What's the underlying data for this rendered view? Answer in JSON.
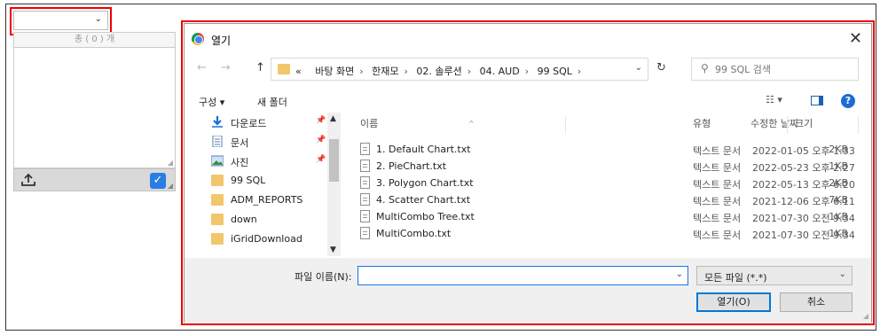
{
  "left_panel": {
    "count_label": "총 ( 0 ) 개",
    "combo_value": ""
  },
  "dialog": {
    "title": "열기",
    "breadcrumbs": [
      "«",
      "바탕 화면",
      "한재모",
      "02. 솔루션",
      "04. AUD",
      "99 SQL"
    ],
    "search_placeholder": "99 SQL 검색",
    "organize_label": "구성 ▾",
    "new_folder_label": "새 폴더",
    "nav_items": [
      {
        "label": "다운로드",
        "icon": "download-arrow-icon",
        "pinned": true
      },
      {
        "label": "문서",
        "icon": "document-icon",
        "pinned": true
      },
      {
        "label": "사진",
        "icon": "picture-icon",
        "pinned": true
      },
      {
        "label": "99 SQL",
        "icon": "folder-icon",
        "pinned": false
      },
      {
        "label": "ADM_REPORTS",
        "icon": "folder-icon",
        "pinned": false
      },
      {
        "label": "down",
        "icon": "folder-icon",
        "pinned": false
      },
      {
        "label": "iGridDownload",
        "icon": "folder-icon",
        "pinned": false
      }
    ],
    "columns": {
      "name": "이름",
      "modified": "수정한 날짜",
      "type": "유형",
      "size": "크기"
    },
    "files": [
      {
        "name": "1. Default Chart.txt",
        "modified": "2022-01-05 오후 1:33",
        "type": "텍스트 문서",
        "size": "2KB"
      },
      {
        "name": "2. PieChart.txt",
        "modified": "2022-05-23 오후 2:27",
        "type": "텍스트 문서",
        "size": "1KB"
      },
      {
        "name": "3. Polygon Chart.txt",
        "modified": "2022-05-13 오후 6:20",
        "type": "텍스트 문서",
        "size": "2KB"
      },
      {
        "name": "4. Scatter Chart.txt",
        "modified": "2021-12-06 오후 6:11",
        "type": "텍스트 문서",
        "size": "7KB"
      },
      {
        "name": "MultiCombo Tree.txt",
        "modified": "2021-07-30 오전 9:34",
        "type": "텍스트 문서",
        "size": "1KB"
      },
      {
        "name": "MultiCombo.txt",
        "modified": "2021-07-30 오전 9:34",
        "type": "텍스트 문서",
        "size": "1KB"
      }
    ],
    "filename_label": "파일 이름(N):",
    "filename_value": "",
    "file_type_value": "모든 파일 (*.*)",
    "open_label": "열기(O)",
    "cancel_label": "취소"
  },
  "colors": {
    "highlight": "#e00000",
    "accent": "#0078d7"
  }
}
